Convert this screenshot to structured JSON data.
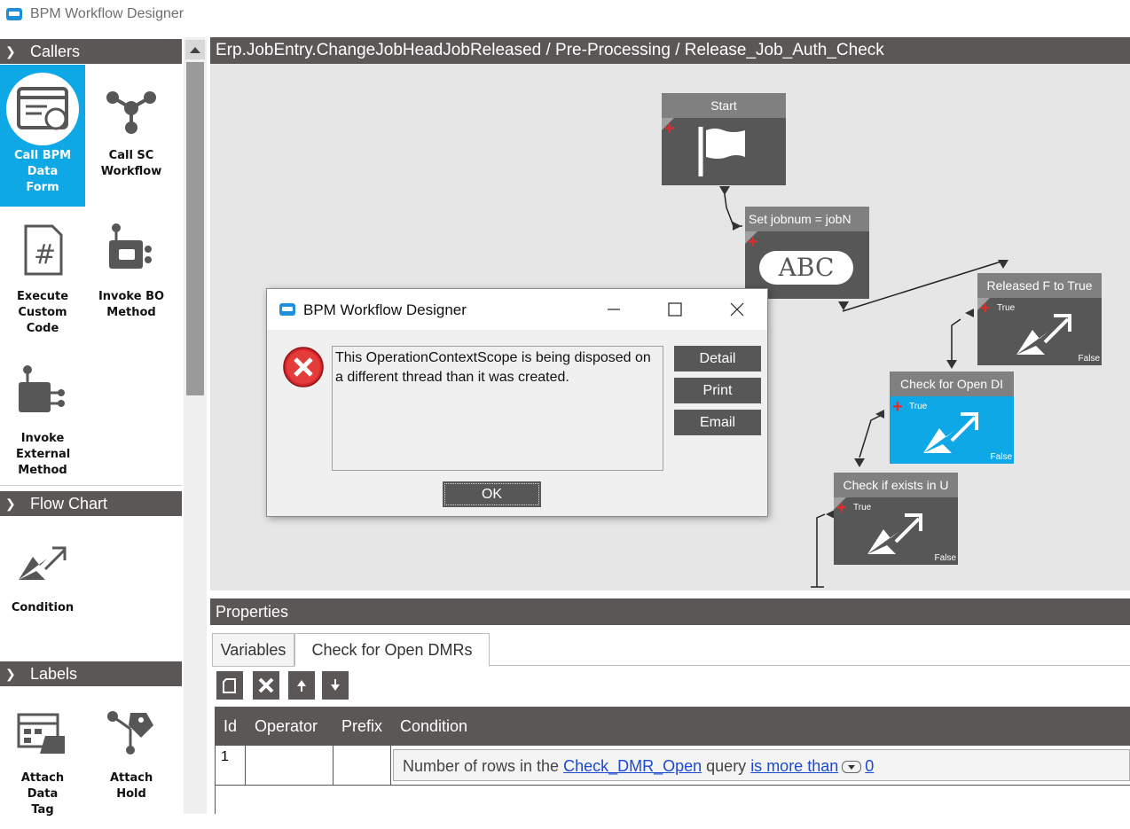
{
  "app": {
    "title": "BPM Workflow Designer"
  },
  "palette": {
    "sections": [
      {
        "label": "Callers"
      },
      {
        "label": "Flow Chart"
      },
      {
        "label": "Labels"
      }
    ],
    "tools": [
      {
        "label": "Call BPM Data Form",
        "icon": "data-form-icon",
        "selected": true
      },
      {
        "label": "Call SC Workflow",
        "icon": "workflow-icon"
      },
      {
        "label": "Execute Custom Code",
        "icon": "code-hash-icon"
      },
      {
        "label": "Invoke BO Method",
        "icon": "method-icon"
      },
      {
        "label": "Invoke External Method",
        "icon": "external-method-icon"
      },
      {
        "label": "Condition",
        "icon": "condition-icon"
      },
      {
        "label": "Attach Data Tag",
        "icon": "data-tag-icon"
      },
      {
        "label": "Attach Hold",
        "icon": "hold-icon"
      }
    ]
  },
  "canvas": {
    "breadcrumb": "Erp.JobEntry.ChangeJobHeadJobReleased / Pre-Processing / Release_Job_Auth_Check",
    "nodes": [
      {
        "title": "Start"
      },
      {
        "title": "Set jobnum = jobN",
        "body": "ABC"
      },
      {
        "title": "Released F to True",
        "true": "True",
        "false": "False"
      },
      {
        "title": "Check for Open DI",
        "true": "True",
        "false": "False",
        "selected": true
      },
      {
        "title": "Check if exists in U",
        "true": "True",
        "false": "False"
      }
    ]
  },
  "properties": {
    "title": "Properties",
    "tabs": [
      {
        "label": "Variables"
      },
      {
        "label": "Check for Open DMRs",
        "active": true
      }
    ],
    "columns": [
      "Id",
      "Operator",
      "Prefix",
      "Condition"
    ],
    "rows": [
      {
        "id": "1",
        "operator": "",
        "prefix": "",
        "condition": {
          "text1": "Number of rows in the ",
          "link1": "Check_DMR_Open",
          "text2": " query ",
          "link2": "is more than",
          "link3": "0"
        }
      }
    ]
  },
  "dialog": {
    "title": "BPM Workflow Designer",
    "message": "This OperationContextScope is being disposed on a different thread than it was created.",
    "buttons": {
      "detail": "Detail",
      "print": "Print",
      "email": "Email",
      "ok": "OK"
    }
  },
  "colors": {
    "accent": "#0fa8e6",
    "header": "#5b5756",
    "error": "#e32b2b"
  }
}
